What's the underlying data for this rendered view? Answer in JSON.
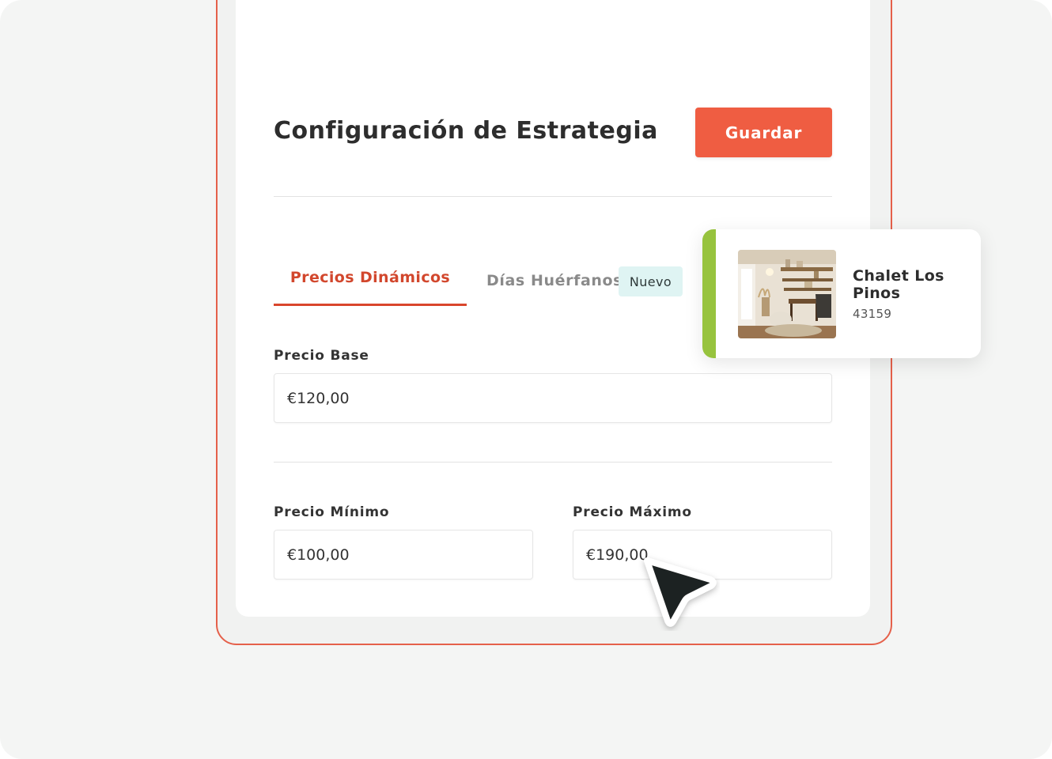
{
  "header": {
    "title": "Configuración de Estrategia",
    "save_label": "Guardar"
  },
  "tabs": [
    {
      "label": "Precios Dinámicos",
      "active": true
    },
    {
      "label": "Días Huérfanos",
      "active": false,
      "badge": "Nuevo"
    }
  ],
  "form": {
    "base_price": {
      "label": "Precio Base",
      "value": "€120,00"
    },
    "min_price": {
      "label": "Precio Mínimo",
      "value": "€100,00"
    },
    "max_price": {
      "label": "Precio Máximo",
      "value": "€190,00"
    }
  },
  "property_card": {
    "name": "Chalet Los Pinos",
    "code": "43159",
    "accent_color": "#97c33e",
    "image": "living-room-photo"
  },
  "colors": {
    "accent": "#ef5d42",
    "active_tab": "#d2472d",
    "badge_bg": "#dff4f3",
    "frame_border": "#e5604a"
  },
  "cursor": {
    "icon": "pointer-arrow-icon"
  }
}
